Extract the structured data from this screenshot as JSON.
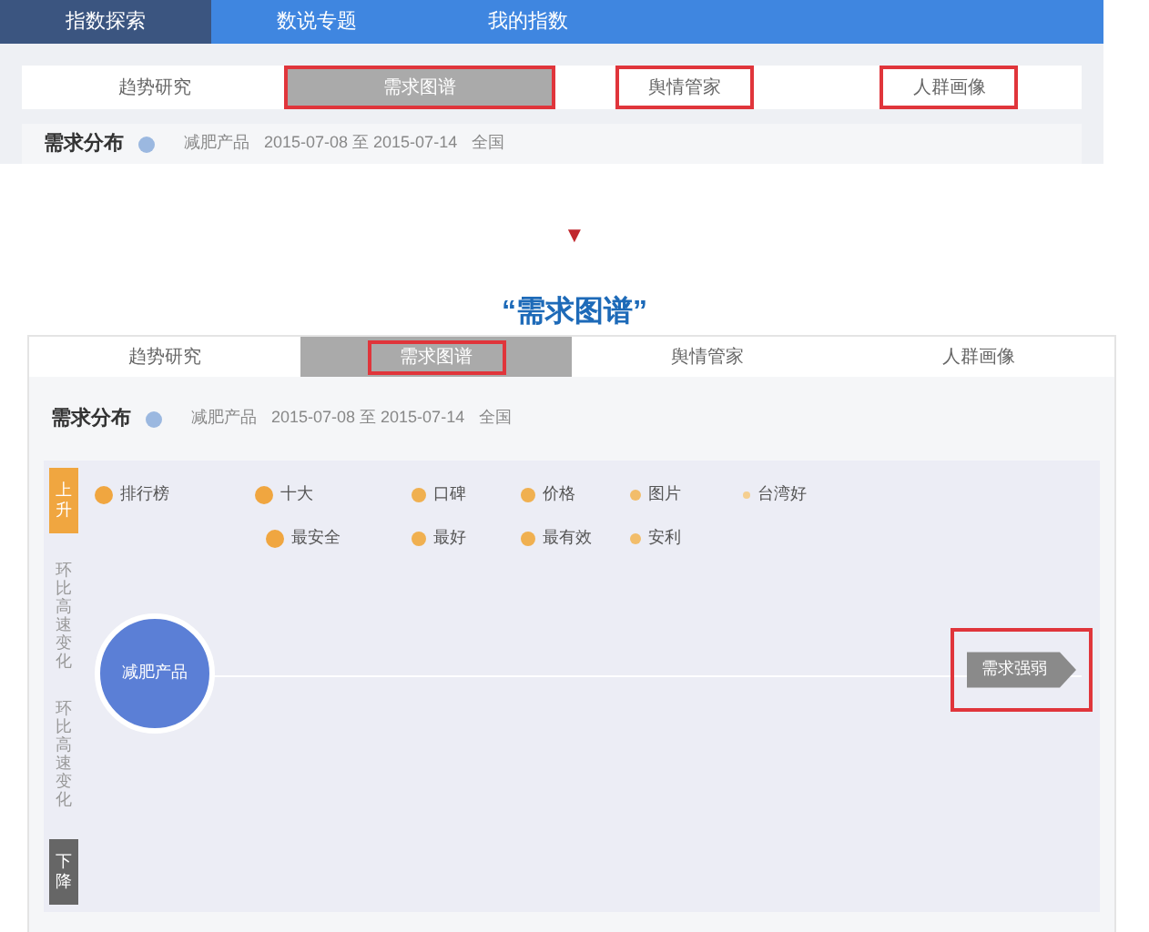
{
  "before": {
    "nav": [
      {
        "label": "指数探索",
        "selected": true
      },
      {
        "label": "数说专题",
        "selected": false
      },
      {
        "label": "我的指数",
        "selected": false
      }
    ],
    "tabs": [
      {
        "label": "趋势研究",
        "selected": false,
        "highlighted": false
      },
      {
        "label": "需求图谱",
        "selected": true,
        "highlighted": true
      },
      {
        "label": "舆情管家",
        "selected": false,
        "highlighted": true
      },
      {
        "label": "人群画像",
        "selected": false,
        "highlighted": true
      }
    ],
    "section": {
      "title": "需求分布",
      "keyword": "减肥产品",
      "date_range": "2015-07-08 至 2015-07-14",
      "region": "全国"
    }
  },
  "arrow": "▼",
  "caption": "“需求图谱”",
  "after": {
    "tabs": [
      {
        "label": "趋势研究",
        "selected": false,
        "highlighted": false
      },
      {
        "label": "需求图谱",
        "selected": true,
        "highlighted": true
      },
      {
        "label": "舆情管家",
        "selected": false,
        "highlighted": false
      },
      {
        "label": "人群画像",
        "selected": false,
        "highlighted": false
      }
    ],
    "section": {
      "title": "需求分布",
      "keyword": "减肥产品",
      "date_range": "2015-07-08 至 2015-07-14",
      "region": "全国"
    },
    "axis": {
      "up": "上升",
      "up_note": "环比高速变化",
      "down_note": "环比高速变化",
      "down": "下降"
    },
    "center": "减肥产品",
    "keywords": [
      [
        {
          "label": "排行榜",
          "kind": "large"
        },
        {
          "label": "十大",
          "kind": "large"
        },
        {
          "label": "口碑",
          "kind": "medium"
        },
        {
          "label": "价格",
          "kind": "medium"
        },
        {
          "label": "图片",
          "kind": "small"
        },
        {
          "label": "台湾好",
          "kind": "tiny"
        }
      ],
      [
        {
          "label": "最安全",
          "kind": "large"
        },
        {
          "label": "最好",
          "kind": "medium"
        },
        {
          "label": "最有效",
          "kind": "medium"
        },
        {
          "label": "安利",
          "kind": "small"
        }
      ]
    ],
    "strength_button": {
      "label": "需求强弱",
      "highlighted": true
    }
  }
}
